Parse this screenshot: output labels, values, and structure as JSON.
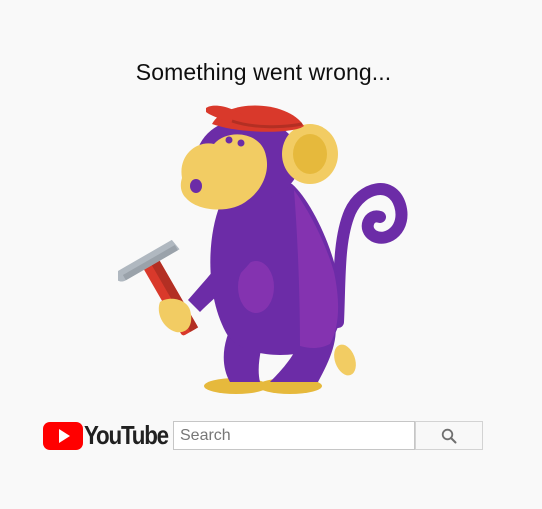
{
  "page": {
    "title": "Something went wrong..."
  },
  "brand": {
    "name": "YouTube",
    "logo_color": "#ff0000"
  },
  "search": {
    "placeholder": "Search",
    "value": "",
    "button_icon": "search-icon"
  },
  "illustration": {
    "name": "monkey-with-hammer",
    "colors": {
      "body": "#6c2ca7",
      "face": "#f2cc63",
      "cap": "#d9392b",
      "hammer_handle": "#d9392b",
      "hammer_head": "#b0b8c0"
    }
  }
}
